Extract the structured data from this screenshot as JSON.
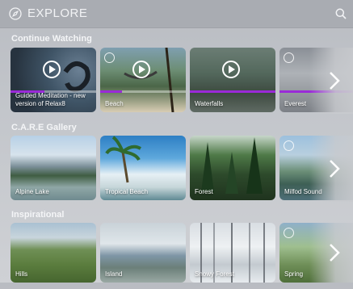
{
  "header": {
    "title": "EXPLORE",
    "compass_icon": "compass-icon",
    "search_icon": "search-icon"
  },
  "sections": [
    {
      "title": "Continue Watching",
      "cards": [
        {
          "label": "Guided Meditation - new version of Relax8",
          "progress": 0.4,
          "play": true,
          "badge": false
        },
        {
          "label": "Beach",
          "progress": 0.25,
          "play": true,
          "badge": true
        },
        {
          "label": "Waterfalls",
          "progress": 1.0,
          "play": true,
          "badge": false
        },
        {
          "label": "Everest",
          "progress": 1.0,
          "play": false,
          "badge": true
        }
      ]
    },
    {
      "title": "C.A.R.E Gallery",
      "cards": [
        {
          "label": "Alpine Lake",
          "badge": false
        },
        {
          "label": "Tropical Beach",
          "badge": false
        },
        {
          "label": "Forest",
          "badge": false
        },
        {
          "label": "Milfod Sound",
          "badge": true
        }
      ]
    },
    {
      "title": "Inspirational",
      "cards": [
        {
          "label": "Hills",
          "badge": false
        },
        {
          "label": "Island",
          "badge": false
        },
        {
          "label": "Snowy Forest",
          "badge": false
        },
        {
          "label": "Spring",
          "badge": true
        }
      ]
    }
  ],
  "colors": {
    "accent": "#9a2ad8",
    "header_bg": "#a9acb2",
    "text": "#ffffff"
  },
  "next_icon": "chevron-right-icon"
}
